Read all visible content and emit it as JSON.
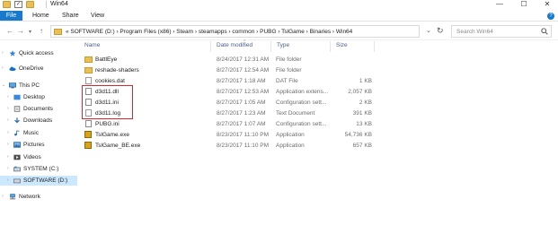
{
  "window": {
    "title": "Win64",
    "min_glyph": "—",
    "max_glyph": "☐",
    "close_glyph": "✕"
  },
  "ribbon": {
    "tabs": [
      "File",
      "Home",
      "Share",
      "View"
    ],
    "help_glyph": "?"
  },
  "address": {
    "path": "«  SOFTWARE (D:)  ›  Program Files (x86)  ›  Steam  ›  steamapps  ›  common  ›  PUBG  ›  TslGame  ›  Binaries  ›  Win64",
    "search_placeholder": "Search Win64"
  },
  "nav": {
    "items": [
      {
        "label": "Quick access",
        "icon": "star-icon"
      },
      {
        "label": "OneDrive",
        "icon": "cloud-icon"
      },
      {
        "label": "This PC",
        "icon": "pc-icon"
      },
      {
        "label": "Desktop",
        "icon": "desktop-icon"
      },
      {
        "label": "Documents",
        "icon": "documents-icon"
      },
      {
        "label": "Downloads",
        "icon": "downloads-icon"
      },
      {
        "label": "Music",
        "icon": "music-icon"
      },
      {
        "label": "Pictures",
        "icon": "pictures-icon"
      },
      {
        "label": "Videos",
        "icon": "videos-icon"
      },
      {
        "label": "SYSTEM (C:)",
        "icon": "drive-icon"
      },
      {
        "label": "SOFTWARE (D:)",
        "icon": "drive-icon"
      },
      {
        "label": "Network",
        "icon": "network-icon"
      }
    ]
  },
  "columns": {
    "name": "Name",
    "date": "Date modified",
    "type": "Type",
    "size": "Size",
    "sort_glyph": "^"
  },
  "files": [
    {
      "name": "BattlEye",
      "date": "8/24/2017 12:31 AM",
      "type": "File folder",
      "size": "",
      "icon": "folder-icon"
    },
    {
      "name": "reshade-shaders",
      "date": "8/27/2017 12:54 AM",
      "type": "File folder",
      "size": "",
      "icon": "folder-icon"
    },
    {
      "name": "cookies.dat",
      "date": "8/27/2017 1:18 AM",
      "type": "DAT File",
      "size": "1 KB",
      "icon": "file-icon"
    },
    {
      "name": "d3d11.dll",
      "date": "8/27/2017 12:53 AM",
      "type": "Application extens...",
      "size": "2,057 KB",
      "icon": "dll-icon"
    },
    {
      "name": "d3d11.ini",
      "date": "8/27/2017 1:05 AM",
      "type": "Configuration sett...",
      "size": "2 KB",
      "icon": "settings-file-icon"
    },
    {
      "name": "d3d11.log",
      "date": "8/27/2017 1:23 AM",
      "type": "Text Document",
      "size": "391 KB",
      "icon": "text-file-icon"
    },
    {
      "name": "PUBG.ini",
      "date": "8/27/2017 1:07 AM",
      "type": "Configuration sett...",
      "size": "13 KB",
      "icon": "settings-file-icon"
    },
    {
      "name": "TslGame.exe",
      "date": "8/23/2017 11:10 PM",
      "type": "Application",
      "size": "54,736 KB",
      "icon": "exe-icon"
    },
    {
      "name": "TslGame_BE.exe",
      "date": "8/23/2017 11:10 PM",
      "type": "Application",
      "size": "657 KB",
      "icon": "exe-icon"
    }
  ],
  "colors": {
    "accent": "#1979ca",
    "selected": "#cce8ff",
    "highlight_box": "#d9262c"
  }
}
